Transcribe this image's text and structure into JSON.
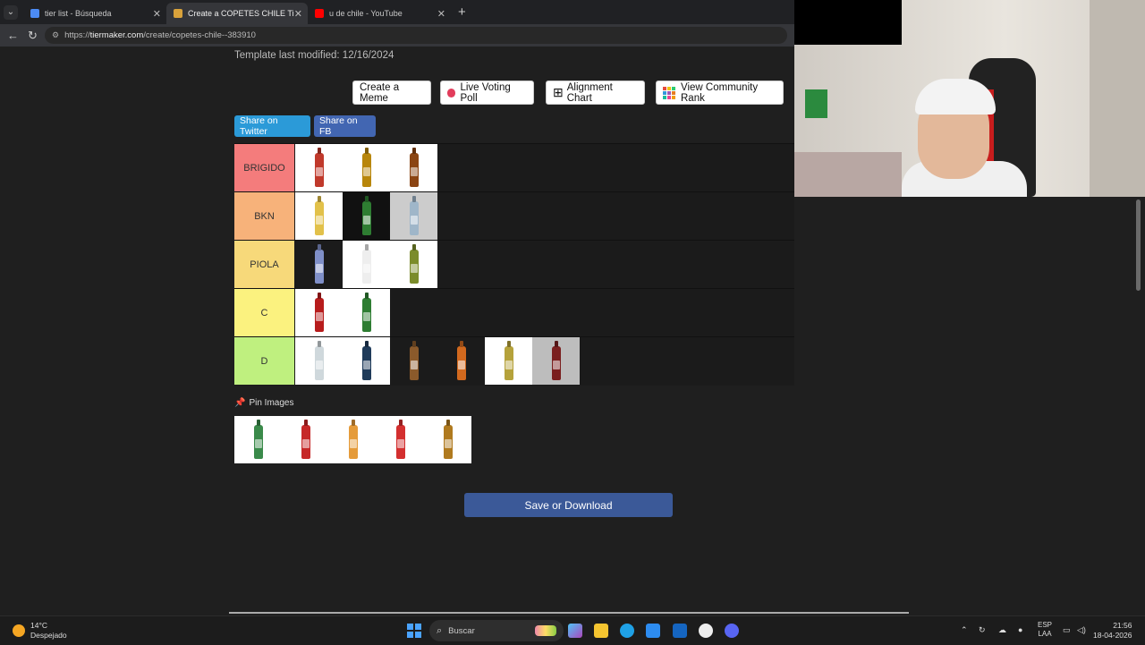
{
  "browser": {
    "tabs": [
      {
        "title": "tier list - Búsqueda",
        "color": "#4c8bf5"
      },
      {
        "title": "Create a COPETES CHILE Tier List -",
        "color": "#d9a23b"
      },
      {
        "title": "u de chile - YouTube",
        "color": "#ff0000"
      }
    ],
    "new_tab_icon": "+",
    "url_prefix": "https://",
    "url_host": "tiermaker.com",
    "url_path": "/create/copetes-chile--383910"
  },
  "page": {
    "template_modified": "Template last modified: 12/16/2024",
    "actions": {
      "create_meme": "Create a Meme",
      "live_voting": "Live Voting Poll",
      "alignment": "Alignment Chart",
      "community": "View Community Rank"
    },
    "share_twitter": "Share on Twitter",
    "share_fb": "Share on FB",
    "tiers": [
      {
        "label": "BRIGIDO",
        "color": "#f47c7c",
        "items": [
          {
            "bg": "#ffffff",
            "bottle": "#c0392b"
          },
          {
            "bg": "#ffffff",
            "bottle": "#b8860b"
          },
          {
            "bg": "#ffffff",
            "bottle": "#8b4513"
          }
        ]
      },
      {
        "label": "BKN",
        "color": "#f7b27a",
        "items": [
          {
            "bg": "#ffffff",
            "bottle": "#e2c14a"
          },
          {
            "bg": "#111111",
            "bottle": "#2e7d32"
          },
          {
            "bg": "#cccccc",
            "bottle": "#9fb6c9"
          }
        ]
      },
      {
        "label": "PIOLA",
        "color": "#f7d97a",
        "items": [
          {
            "bg": "#1b1b1b",
            "bottle": "#7f8fc8"
          },
          {
            "bg": "#ffffff",
            "bottle": "#eeeeee"
          },
          {
            "bg": "#ffffff",
            "bottle": "#7b8c2b"
          }
        ]
      },
      {
        "label": "C",
        "color": "#fbf27f",
        "items": [
          {
            "bg": "#ffffff",
            "bottle": "#b71c1c"
          },
          {
            "bg": "#ffffff",
            "bottle": "#2e7d32"
          }
        ]
      },
      {
        "label": "D",
        "color": "#bff07f",
        "items": [
          {
            "bg": "#ffffff",
            "bottle": "#cfd8dc"
          },
          {
            "bg": "#ffffff",
            "bottle": "#1f3b5a"
          },
          {
            "bg": "#1b1b1b",
            "bottle": "#8b5a2b"
          },
          {
            "bg": "#1b1b1b",
            "bottle": "#d2691e"
          },
          {
            "bg": "#ffffff",
            "bottle": "#b5a23b"
          },
          {
            "bg": "#bdbdbd",
            "bottle": "#7a1f1f"
          }
        ]
      }
    ],
    "pin_label": "Pin Images",
    "pool_items": [
      {
        "bg": "#ffffff",
        "bottle": "#3a8a4a"
      },
      {
        "bg": "#ffffff",
        "bottle": "#c62828"
      },
      {
        "bg": "#ffffff",
        "bottle": "#e59b3a"
      },
      {
        "bg": "#ffffff",
        "bottle": "#d32f2f"
      },
      {
        "bg": "#ffffff",
        "bottle": "#b07a1f"
      }
    ],
    "save_label": "Save or Download"
  },
  "taskbar": {
    "temp": "14°C",
    "weather": "Despejado",
    "search": "Buscar",
    "lang_1": "ESP",
    "lang_2": "LAA",
    "time": "21:56",
    "date": "18-04-2026"
  }
}
